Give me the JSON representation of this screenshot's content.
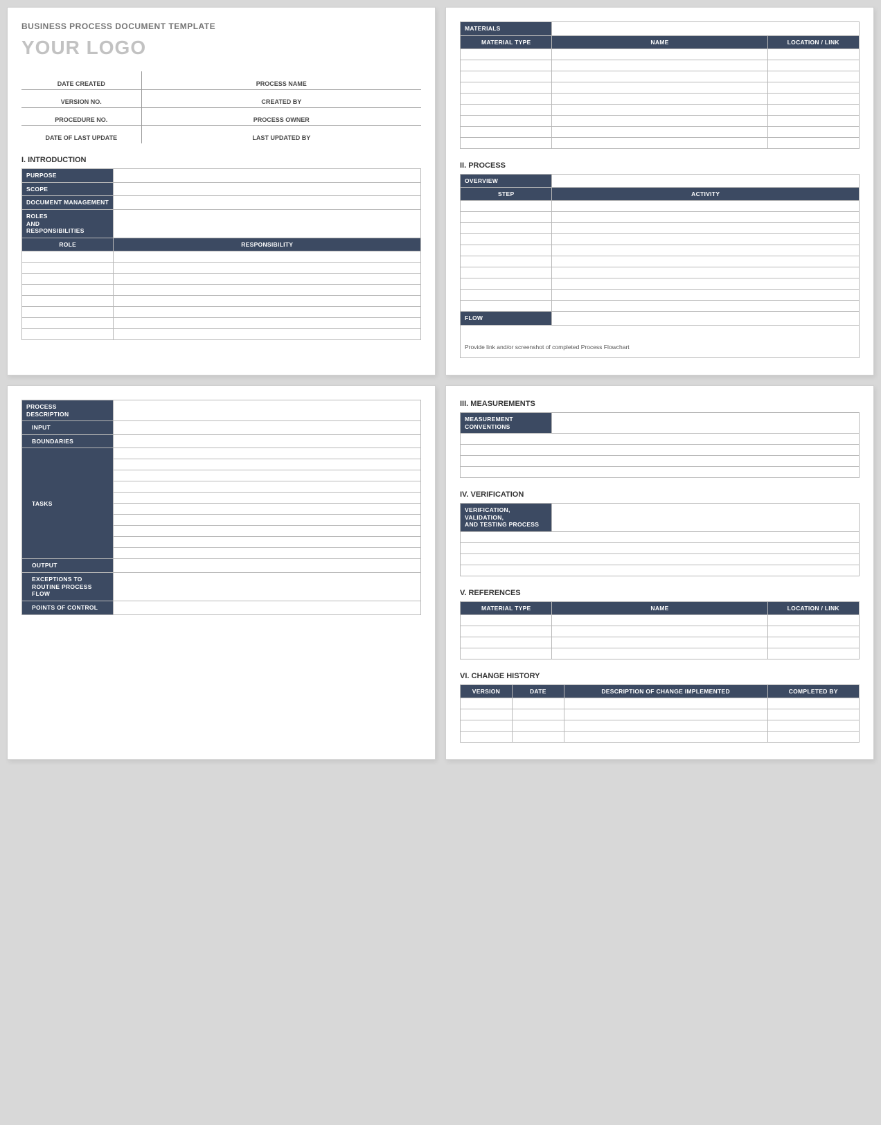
{
  "header": {
    "doc_title": "BUSINESS PROCESS DOCUMENT TEMPLATE",
    "logo": "YOUR LOGO"
  },
  "meta": {
    "date_created": "DATE CREATED",
    "process_name": "PROCESS NAME",
    "version_no": "VERSION NO.",
    "created_by": "CREATED BY",
    "procedure_no": "PROCEDURE NO.",
    "process_owner": "PROCESS OWNER",
    "date_last_update": "DATE OF LAST UPDATE",
    "last_updated_by": "LAST UPDATED BY"
  },
  "sections": {
    "introduction": "I.   INTRODUCTION",
    "process": "II.   PROCESS",
    "measurements": "III.  MEASUREMENTS",
    "verification": "IV.  VERIFICATION",
    "references": "V.  REFERENCES",
    "change_history": "VI.  CHANGE HISTORY"
  },
  "introduction": {
    "purpose": "PURPOSE",
    "scope": "SCOPE",
    "doc_management": "DOCUMENT MANAGEMENT",
    "roles_resp": "ROLES\nAND\nRESPONSIBILITIES",
    "role_col": "ROLE",
    "responsibility_col": "RESPONSIBILITY"
  },
  "materials": {
    "label": "MATERIALS",
    "col_type": "MATERIAL TYPE",
    "col_name": "NAME",
    "col_loc": "LOCATION / LINK"
  },
  "process": {
    "overview": "OVERVIEW",
    "step_col": "STEP",
    "activity_col": "ACTIVITY",
    "flow": "FLOW",
    "flow_note": "Provide link and/or screenshot of completed Process Flowchart"
  },
  "process_description": {
    "label": "PROCESS\nDESCRIPTION",
    "input": "INPUT",
    "boundaries": "BOUNDARIES",
    "tasks": "TASKS",
    "output": "OUTPUT",
    "exceptions": "EXCEPTIONS TO\nROUTINE PROCESS FLOW",
    "points_of_control": "POINTS OF CONTROL"
  },
  "measurements": {
    "label": "MEASUREMENT\nCONVENTIONS"
  },
  "verification": {
    "label": "VERIFICATION, VALIDATION,\nAND TESTING PROCESS"
  },
  "references": {
    "col_type": "MATERIAL TYPE",
    "col_name": "NAME",
    "col_loc": "LOCATION / LINK"
  },
  "change_history": {
    "col_version": "VERSION",
    "col_date": "DATE",
    "col_desc": "DESCRIPTION OF CHANGE IMPLEMENTED",
    "col_by": "COMPLETED BY"
  }
}
